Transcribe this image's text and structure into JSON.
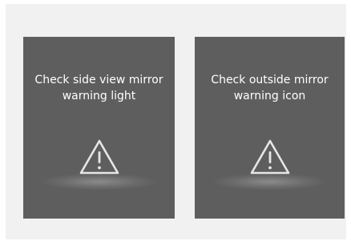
{
  "panels": [
    {
      "line1": "Check side view mirror",
      "line2": "warning light",
      "icon": "warning-triangle-icon"
    },
    {
      "line1": "Check outside mirror",
      "line2": "warning icon",
      "icon": "warning-triangle-icon"
    }
  ],
  "colors": {
    "frame_background": "#f1f1f1",
    "panel_background": "#5e5e5e",
    "text": "#ffffff",
    "icon": "#e6e6e6"
  }
}
